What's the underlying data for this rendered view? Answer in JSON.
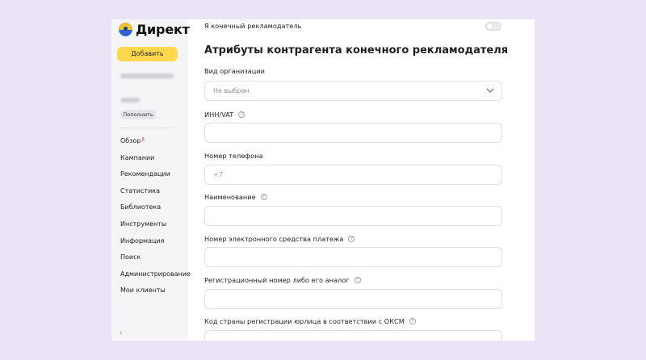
{
  "sidebar": {
    "logo_text": "Директ",
    "add_button": "Добавить",
    "topup_button": "Пополнить",
    "nav": [
      {
        "label": "Обзор",
        "badge": "β"
      },
      {
        "label": "Кампании"
      },
      {
        "label": "Рекомендации"
      },
      {
        "label": "Статистика"
      },
      {
        "label": "Библиотека"
      },
      {
        "label": "Инструменты"
      },
      {
        "label": "Информация"
      },
      {
        "label": "Поиск"
      },
      {
        "label": "Администрирование"
      },
      {
        "label": "Мои клиенты"
      }
    ],
    "collapse_icon": "‹"
  },
  "form": {
    "end_advertiser_label": "Я конечный рекламодатель",
    "end_advertiser_on": false,
    "section_title": "Атрибуты контрагента конечного рекламодателя",
    "org_type_label": "Вид организации",
    "org_type_value": "Не выбран",
    "inn_label": "ИНН/VAT",
    "inn_value": "",
    "phone_label": "Номер телефона",
    "phone_placeholder": "+7",
    "name_label": "Наименование",
    "name_value": "",
    "payment_label": "Номер электронного средства платежа",
    "payment_value": "",
    "reg_label": "Регистрационный номер либо его аналог",
    "reg_value": "",
    "country_label": "Код страны регистрации юрлица в соответствии с ОКСМ",
    "country_value": ""
  },
  "icons": {
    "help": "?"
  },
  "colors": {
    "accent": "#ffd84d",
    "background": "#ebe3f6",
    "sidebar": "#f5f5f7"
  }
}
